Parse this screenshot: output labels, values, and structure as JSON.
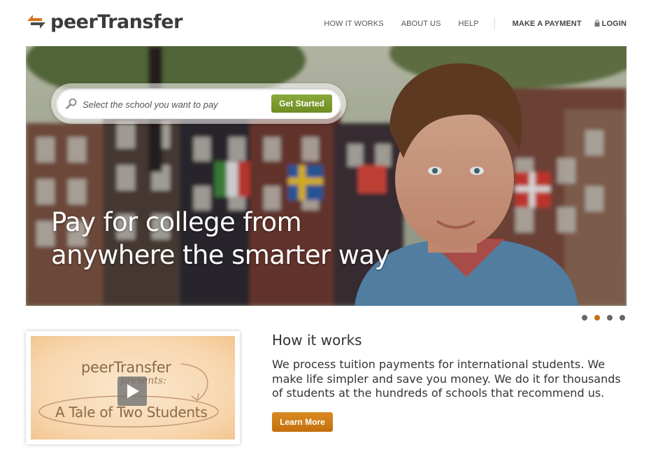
{
  "header": {
    "logo_text": "peerTransfer",
    "nav": {
      "how_it_works": "HOW IT WORKS",
      "about_us": "ABOUT US",
      "help": "HELP",
      "make_payment": "MAKE A PAYMENT",
      "login": "LOGIN"
    }
  },
  "hero": {
    "search_placeholder": "Select the school you want to pay",
    "get_started_label": "Get Started",
    "headline_line1": "Pay for college from",
    "headline_line2": "anywhere the smarter way"
  },
  "carousel": {
    "slide_count": 4,
    "active_index": 1
  },
  "video": {
    "brand": "peerTransfer",
    "presents": "presents:",
    "title": "A Tale of Two Students"
  },
  "how_it_works": {
    "title": "How it works",
    "body": "We process tuition payments for international students. We make life simpler and save you money. We do it for thousands of students at the hundreds of schools that recommend us.",
    "learn_more_label": "Learn More"
  },
  "colors": {
    "accent_orange": "#c87010",
    "accent_green": "#7a9a2c",
    "text_dark": "#333333"
  },
  "icons": [
    "logo-arrows-icon",
    "lock-icon",
    "search-icon",
    "play-icon"
  ]
}
